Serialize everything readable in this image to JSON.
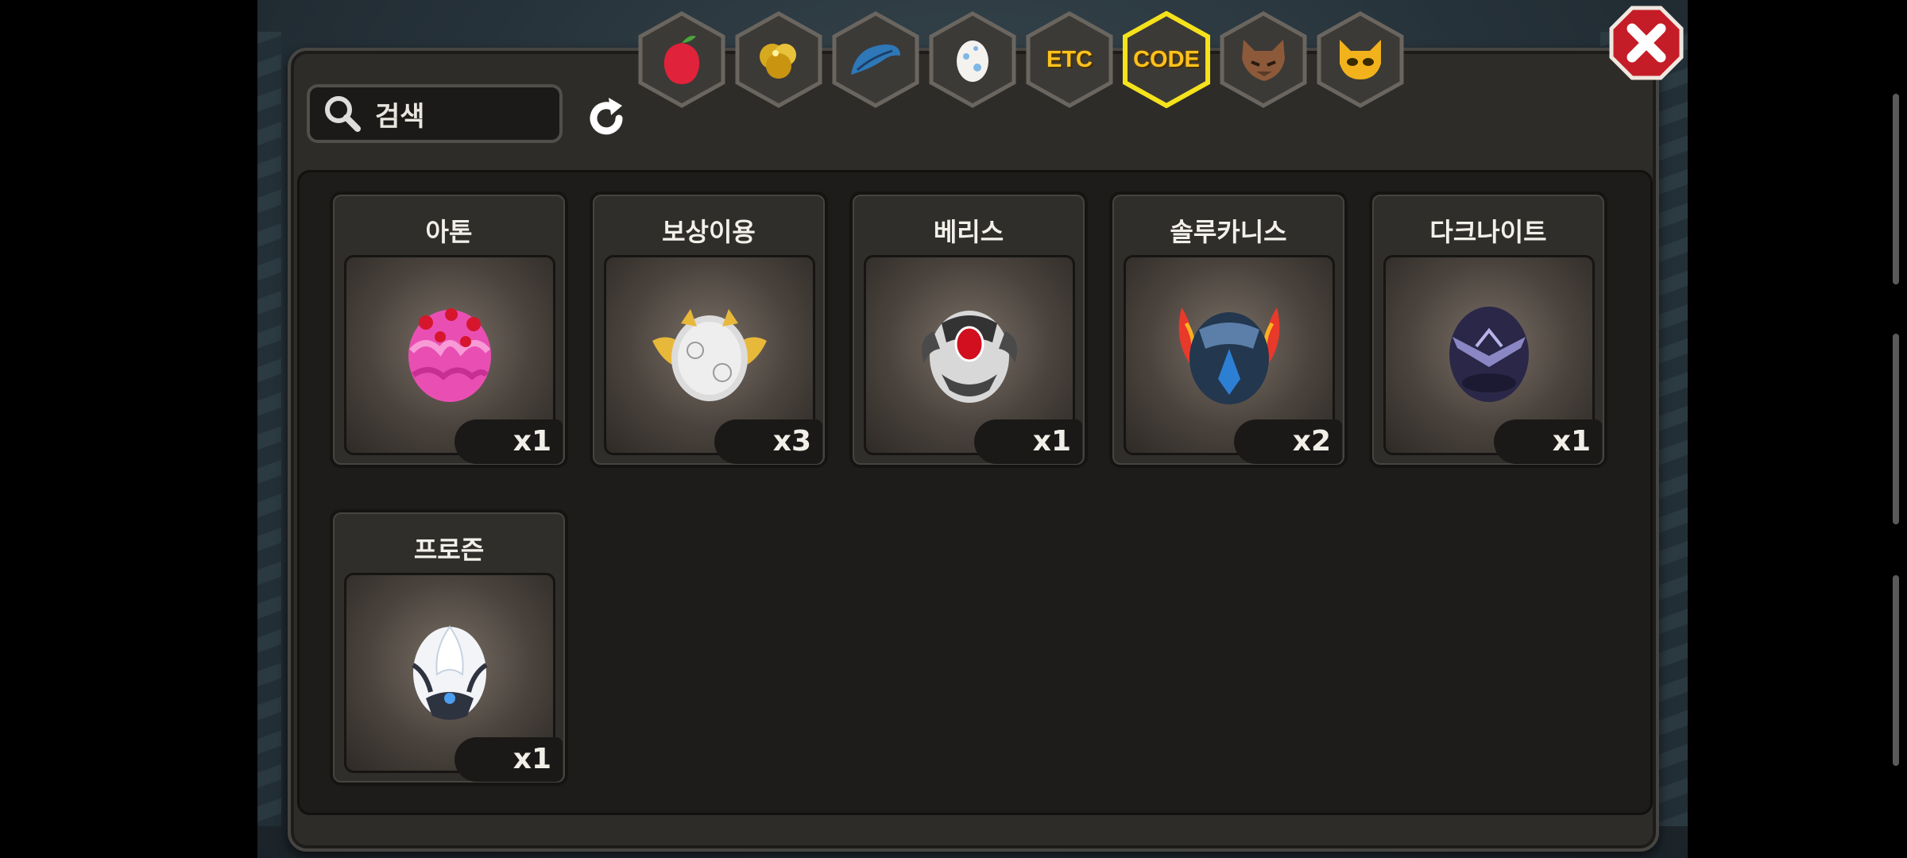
{
  "search": {
    "placeholder": "검색"
  },
  "tabs": [
    {
      "id": "fruit",
      "label": "",
      "icon": "fruit-icon",
      "selected": false
    },
    {
      "id": "gold",
      "label": "",
      "icon": "gold-ore-icon",
      "selected": false
    },
    {
      "id": "feather",
      "label": "",
      "icon": "blue-feather-icon",
      "selected": false
    },
    {
      "id": "egg",
      "label": "",
      "icon": "egg-icon",
      "selected": false
    },
    {
      "id": "etc",
      "label": "ETC",
      "icon": "etc-text-icon",
      "selected": false
    },
    {
      "id": "code",
      "label": "CODE",
      "icon": "code-text-icon",
      "selected": true
    },
    {
      "id": "wolf",
      "label": "",
      "icon": "wolf-head-icon",
      "selected": false
    },
    {
      "id": "mask",
      "label": "",
      "icon": "cat-mask-icon",
      "selected": false
    }
  ],
  "items": [
    {
      "name": "아톤",
      "quantity": "x1",
      "egg": "pink-egg-icon"
    },
    {
      "name": "보상이용",
      "quantity": "x3",
      "egg": "winged-white-egg-icon"
    },
    {
      "name": "베리스",
      "quantity": "x1",
      "egg": "horned-ruby-egg-icon"
    },
    {
      "name": "솔루카니스",
      "quantity": "x2",
      "egg": "flame-blue-egg-icon"
    },
    {
      "name": "다크나이트",
      "quantity": "x1",
      "egg": "dark-egg-icon"
    },
    {
      "name": "프로즌",
      "quantity": "x1",
      "egg": "frozen-egg-icon"
    }
  ],
  "colors": {
    "tab_selected_border": "#f5e21c",
    "tab_text": "#ffc21e",
    "close_red": "#d3202a"
  }
}
